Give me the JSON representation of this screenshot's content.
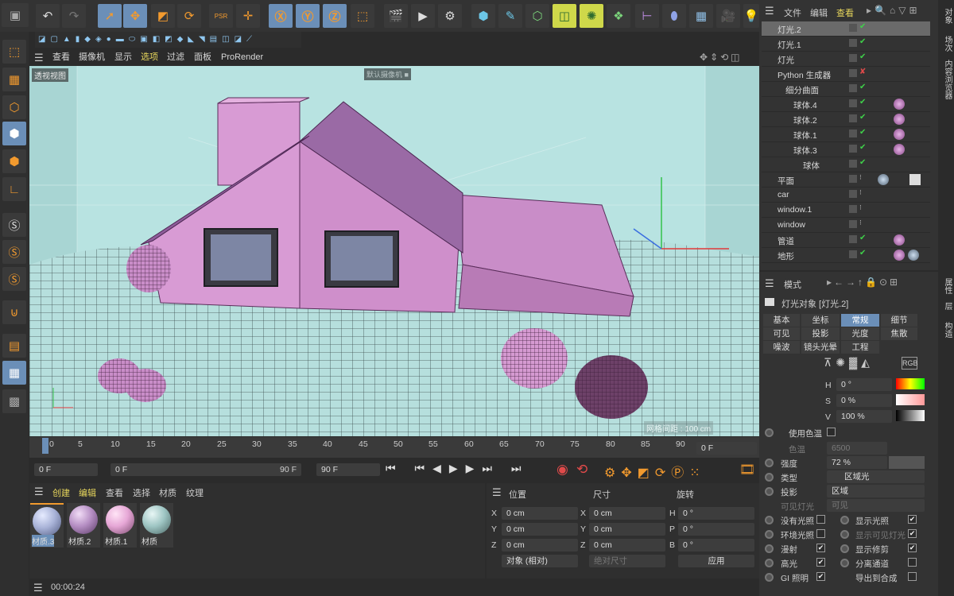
{
  "menubar": {
    "items": [
      "查看",
      "摄像机",
      "显示",
      "选项",
      "过滤",
      "面板",
      "ProRender"
    ]
  },
  "viewport": {
    "label": "透视视图",
    "grid_label": "网格间距 : 100 cm",
    "camera_label": "默认摄像机 ■"
  },
  "right_menu": {
    "items": [
      "文件",
      "编辑",
      "查看"
    ]
  },
  "objects": [
    {
      "name": "灯光.2",
      "highlight": true,
      "tick": true
    },
    {
      "name": "灯光.1",
      "tick": true
    },
    {
      "name": "灯光",
      "tick": true
    },
    {
      "name": "Python 生成器",
      "tick": false,
      "cross": true
    },
    {
      "name": "细分曲面",
      "tick": true
    },
    {
      "name": "球体.4",
      "tick": true
    },
    {
      "name": "球体.2",
      "tick": true
    },
    {
      "name": "球体.1",
      "tick": true
    },
    {
      "name": "球体.3",
      "tick": true
    },
    {
      "name": "球体",
      "tick": true
    },
    {
      "name": "平面",
      "tick": false
    },
    {
      "name": "car",
      "tick": false
    },
    {
      "name": "window.1",
      "tick": false
    },
    {
      "name": "window",
      "tick": false
    },
    {
      "name": "管道",
      "tick": true
    },
    {
      "name": "地形",
      "tick": true
    }
  ],
  "side_tabs": {
    "a": "对象",
    "b": "场次",
    "c": "内容浏览器",
    "d": "属性",
    "e": "层",
    "f": "构造"
  },
  "attr": {
    "mode_label": "模式",
    "title": "灯光对象 [灯光.2]",
    "tabs_row1": [
      "基本",
      "坐标",
      "常规",
      "细节"
    ],
    "tabs_row2": [
      "可见",
      "投影",
      "光度",
      "焦散"
    ],
    "tabs_row3": [
      "噪波",
      "镜头光晕",
      "工程"
    ],
    "rgb_label": "RGB",
    "h_label": "H",
    "h_value": "0 °",
    "s_label": "S",
    "s_value": "0 %",
    "v_label": "V",
    "v_value": "100 %",
    "use_temp": "使用色温",
    "temp_label": "色温",
    "temp_value": "6500",
    "intensity_label": "强度",
    "intensity_value": "72 %",
    "type_label": "类型",
    "type_value": "区域光",
    "shadow_label": "投影",
    "shadow_value": "区域",
    "vis_label": "可见灯光",
    "vis_value": "可见",
    "no_light": "没有光照",
    "ambient": "环境光照",
    "diffuse": "漫射",
    "specular": "高光",
    "gi": "GI 照明",
    "show_lighting": "显示光照",
    "show_visible": "显示可见灯光",
    "show_clip": "显示修剪",
    "sep_pass": "分离通道",
    "export": "导出到合成"
  },
  "timeline": {
    "ticks": [
      "0",
      "5",
      "10",
      "15",
      "20",
      "25",
      "30",
      "35",
      "40",
      "45",
      "50",
      "55",
      "60",
      "65",
      "70",
      "75",
      "80",
      "85",
      "90"
    ],
    "current": "0 F",
    "start": "0 F",
    "range_start": "0 F",
    "range_end": "90 F",
    "end": "90 F"
  },
  "materials": {
    "menu": [
      "创建",
      "编辑",
      "查看",
      "选择",
      "材质",
      "纹理"
    ],
    "items": [
      {
        "name": "材质.3",
        "color": "#a9b3d8"
      },
      {
        "name": "材质.2",
        "color": "#b68fc4"
      },
      {
        "name": "材质.1",
        "color": "#e6a7d6"
      },
      {
        "name": "材质",
        "color": "#9fc6c4"
      }
    ]
  },
  "coords": {
    "h1": "位置",
    "h2": "尺寸",
    "h3": "旋转",
    "rows": [
      {
        "a": "X",
        "pos": "0 cm",
        "b": "X",
        "size": "0 cm",
        "c": "H",
        "rot": "0 °"
      },
      {
        "a": "Y",
        "pos": "0 cm",
        "b": "Y",
        "size": "0 cm",
        "c": "P",
        "rot": "0 °"
      },
      {
        "a": "Z",
        "pos": "0 cm",
        "b": "Z",
        "size": "0 cm",
        "c": "B",
        "rot": "0 °"
      }
    ],
    "mode": "对象 (相对)",
    "abs": "绝对尺寸",
    "apply": "应用"
  },
  "status": {
    "time": "00:00:24"
  }
}
